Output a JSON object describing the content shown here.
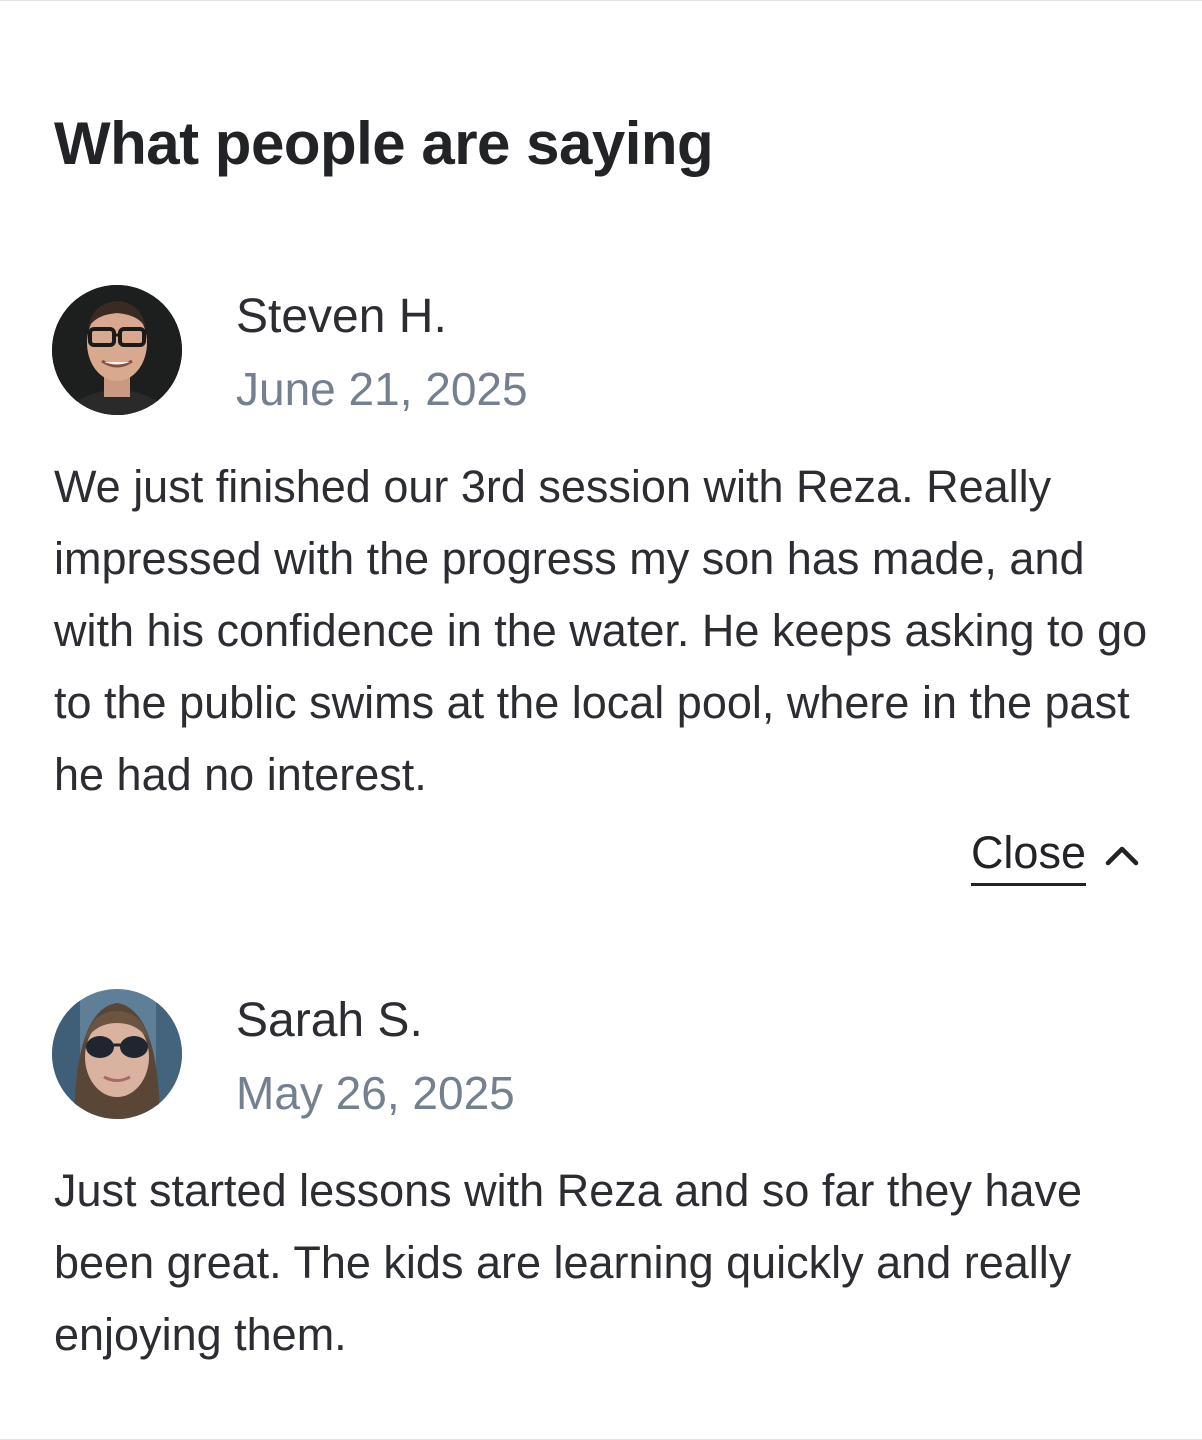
{
  "section": {
    "title": "What people are saying"
  },
  "reviews": [
    {
      "name": "Steven H.",
      "date": "June 21, 2025",
      "text": "We just finished our 3rd session with Reza. Really impressed with the progress my son has made, and with his confidence in the water. He keeps asking to go to the public swims at the local pool, where in the past he had no interest.",
      "toggle_label": "Close",
      "toggle_icon": "chevron-up-icon",
      "avatar": "avatar-man-glasses"
    },
    {
      "name": "Sarah S.",
      "date": "May 26, 2025",
      "text": "Just started lessons with Reza and so far they have been great. The kids are learning quickly and really enjoying them.",
      "avatar": "avatar-woman-sunglasses"
    }
  ],
  "colors": {
    "text_primary": "#2b2d33",
    "text_muted": "#74808f",
    "background": "#ffffff"
  }
}
